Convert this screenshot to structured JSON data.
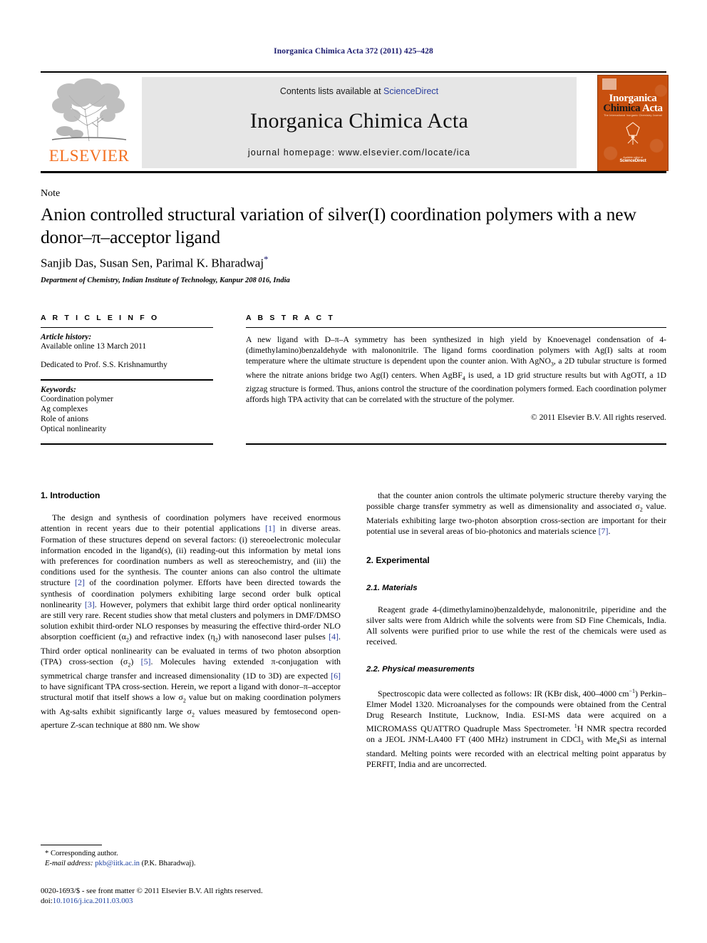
{
  "running_head": "Inorganica Chimica Acta 372 (2011) 425–428",
  "masthead": {
    "elsevier_wordmark": "ELSEVIER",
    "contents_prefix": "Contents lists available at ",
    "sciencedirect": "ScienceDirect",
    "journal_title": "Inorganica Chimica Acta",
    "homepage": "journal homepage: www.elsevier.com/locate/ica",
    "cover": {
      "line1": "Inorganica",
      "line2_black": "Chimica",
      "line2_white": "Acta",
      "subtitle": "The International Inorganic Chemistry Journal",
      "footer_small": "Available online at",
      "footer_brand": "ScienceDirect"
    },
    "accent_orange": "#f37021",
    "link_blue": "#2b3f9e",
    "banner_gray": "#e6e6e6",
    "cover_orange": "#c8500f"
  },
  "article": {
    "type_label": "Note",
    "title": "Anion controlled structural variation of silver(I) coordination polymers with a new donor–π–acceptor ligand",
    "authors": "Sanjib Das, Susan Sen, Parimal K. Bharadwaj",
    "corresponding_marker": "*",
    "affiliation": "Department of Chemistry, Indian Institute of Technology, Kanpur 208 016, India"
  },
  "info": {
    "heading": "A R T I C L E    I N F O",
    "history_label": "Article history:",
    "history_value": "Available online 13 March 2011",
    "dedication": "Dedicated to Prof. S.S. Krishnamurthy",
    "keywords_label": "Keywords:",
    "keywords": [
      "Coordination polymer",
      "Ag complexes",
      "Role of anions",
      "Optical nonlinearity"
    ]
  },
  "abstract": {
    "heading": "A B S T R A C T",
    "text": "A new ligand with D–π–A symmetry has been synthesized in high yield by Knoevenagel condensation of 4-(dimethylamino)benzaldehyde with malononitrile. The ligand forms coordination polymers with Ag(I) salts at room temperature where the ultimate structure is dependent upon the counter anion. With AgNO3, a 2D tubular structure is formed where the nitrate anions bridge two Ag(I) centers. When AgBF4 is used, a 1D grid structure results but with AgOTf, a 1D zigzag structure is formed. Thus, anions control the structure of the coordination polymers formed. Each coordination polymer affords high TPA activity that can be correlated with the structure of the polymer.",
    "copyright": "© 2011 Elsevier B.V. All rights reserved."
  },
  "body": {
    "intro_heading": "1. Introduction",
    "intro_p1": "The design and synthesis of coordination polymers have received enormous attention in recent years due to their potential applications [1] in diverse areas. Formation of these structures depend on several factors: (i) stereoelectronic molecular information encoded in the ligand(s), (ii) reading-out this information by metal ions with preferences for coordination numbers as well as stereochemistry, and (iii) the conditions used for the synthesis. The counter anions can also control the ultimate structure [2] of the coordination polymer. Efforts have been directed towards the synthesis of coordination polymers exhibiting large second order bulk optical nonlinearity [3]. However, polymers that exhibit large third order optical nonlinearity are still very rare. Recent studies show that metal clusters and polymers in DMF/DMSO solution exhibit third-order NLO responses by measuring the effective third-order NLO absorption coefficient (α2) and refractive index (η2) with nanosecond laser pulses [4]. Third order optical nonlinearity can be evaluated in terms of two photon absorption (TPA) cross-section (σ2) [5]. Molecules having extended π-conjugation with symmetrical charge transfer and increased dimensionality (1D to 3D) are expected [6] to have significant TPA cross-section. Herein, we report a ligand with donor–π–acceptor structural motif that itself shows a low σ2 value but on making coordination polymers with Ag-salts exhibit significantly large σ2 values measured by femtosecond open-aperture Z-scan technique at 880 nm. We show",
    "intro_p2": "that the counter anion controls the ultimate polymeric structure thereby varying the possible charge transfer symmetry as well as dimensionality and associated σ2 value. Materials exhibiting large two-photon absorption cross-section are important for their potential use in several areas of bio-photonics and materials science [7].",
    "exp_heading": "2. Experimental",
    "materials_heading": "2.1. Materials",
    "materials_p": "Reagent grade 4-(dimethylamino)benzaldehyde, malononitrile, piperidine and the silver salts were from Aldrich while the solvents were from SD Fine Chemicals, India. All solvents were purified prior to use while the rest of the chemicals were used as received.",
    "physical_heading": "2.2. Physical measurements",
    "physical_p": "Spectroscopic data were collected as follows: IR (KBr disk, 400–4000 cm−1) Perkin–Elmer Model 1320. Microanalyses for the compounds were obtained from the Central Drug Research Institute, Lucknow, India. ESI-MS data were acquired on a MICROMASS QUATTRO Quadruple Mass Spectrometer. 1H NMR spectra recorded on a JEOL JNM-LA400 FT (400 MHz) instrument in CDCl3 with Me4Si as internal standard. Melting points were recorded with an electrical melting point apparatus by PERFIT, India and are uncorrected."
  },
  "footnote": {
    "corresponding_author": "* Corresponding author.",
    "email_label": "E-mail address:",
    "email": "pkb@iitk.ac.in",
    "email_owner": "(P.K. Bharadwaj)."
  },
  "imprint": {
    "line1": "0020-1693/$ - see front matter © 2011 Elsevier B.V. All rights reserved.",
    "doi_label": "doi:",
    "doi_value": "10.1016/j.ica.2011.03.003"
  }
}
